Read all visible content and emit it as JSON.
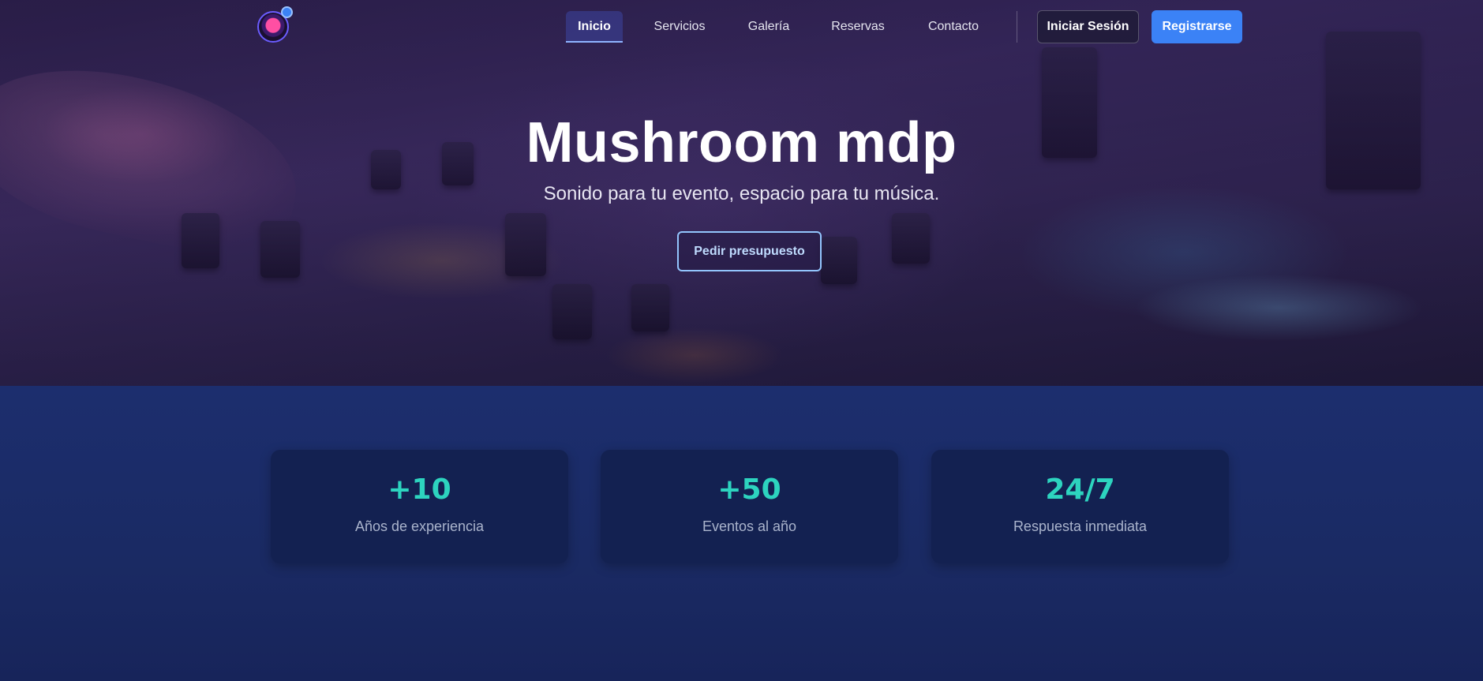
{
  "brand": {
    "logo_icon": "mushroom-logo-icon"
  },
  "nav": {
    "links": [
      {
        "label": "Inicio",
        "active": true
      },
      {
        "label": "Servicios",
        "active": false
      },
      {
        "label": "Galería",
        "active": false
      },
      {
        "label": "Reservas",
        "active": false
      },
      {
        "label": "Contacto",
        "active": false
      }
    ],
    "login_label": "Iniciar Sesión",
    "register_label": "Registrarse"
  },
  "hero": {
    "title": "Mushroom mdp",
    "subtitle": "Sonido para tu evento, espacio para tu música.",
    "cta_label": "Pedir presupuesto"
  },
  "stats": [
    {
      "value": "+10",
      "label": "Años de experiencia"
    },
    {
      "value": "+50",
      "label": "Eventos al año"
    },
    {
      "value": "24/7",
      "label": "Respuesta inmediata"
    }
  ],
  "colors": {
    "accent": "#3b82f6",
    "stat_value": "#2dd4bf",
    "stats_background": "#1b2b68",
    "card_background": "#132151"
  }
}
